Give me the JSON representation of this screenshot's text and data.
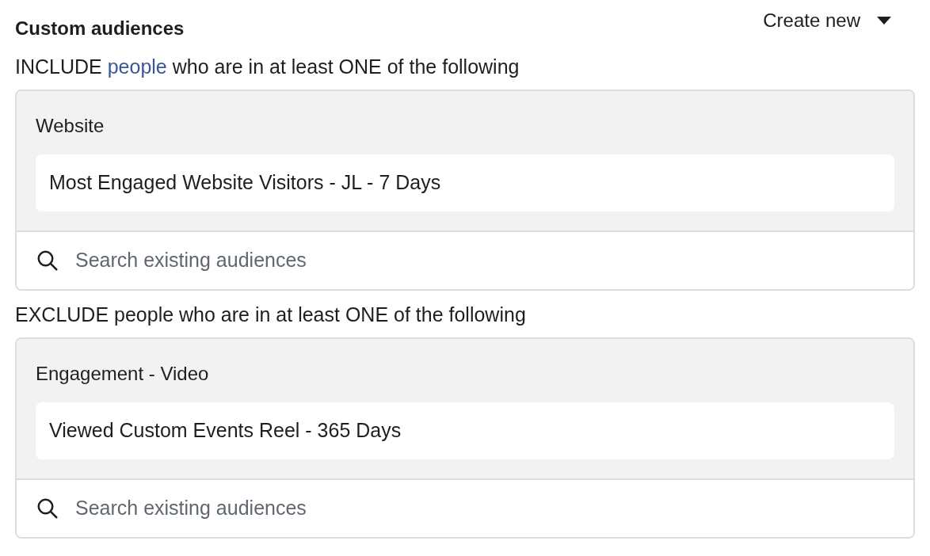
{
  "header": {
    "title": "Custom audiences",
    "create_button": "Create new"
  },
  "sections": [
    {
      "intro": {
        "before": "INCLUDE",
        "link": "people",
        "after": "who are in at least ONE of the following"
      },
      "category": "Website",
      "audiences": [
        "Most Engaged Website Visitors - JL - 7 Days"
      ],
      "search": {
        "placeholder": "Search existing audiences"
      }
    },
    {
      "intro": {
        "before": "EXCLUDE people who are in at least ONE of the following"
      },
      "category": "Engagement - Video",
      "audiences": [
        "Viewed Custom Events Reel - 365 Days"
      ],
      "search": {
        "placeholder": "Search existing audiences"
      }
    }
  ]
}
